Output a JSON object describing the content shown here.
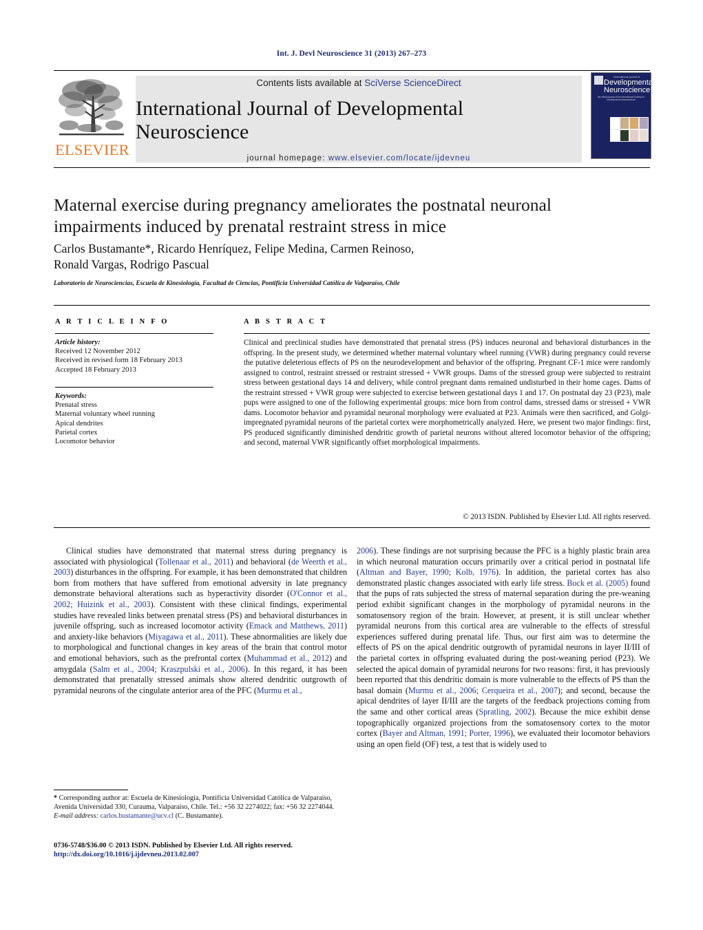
{
  "running_head": "Int. J. Devl Neuroscience 31 (2013) 267–273",
  "masthead": {
    "contents_prefix": "Contents lists available at ",
    "contents_link": "SciVerse ScienceDirect",
    "journal_title": "International Journal of Developmental Neuroscience",
    "homepage_label": "journal homepage:",
    "homepage_url": "www.elsevier.com/locate/ijdevneu",
    "publisher_wordmark": "ELSEVIER",
    "publisher_logo_icon": "elsevier-tree-icon",
    "accent_orange": "#e87722",
    "link_blue": "#2b3a8f"
  },
  "cover": {
    "kicker": "international journal of",
    "title_line1": "Developmental",
    "title_line2": "Neuroscience",
    "subtitle": "the official journal of the International Society for Developmental Neuroscience",
    "background": "#1a2260",
    "panel_colors": [
      "#c9b08a",
      "#d8a96b",
      "#b9a6c4",
      "#8d9cc0",
      "#2a3a2a",
      "#e3cfc7",
      "#ddd0c4",
      "#efe7e0"
    ]
  },
  "article": {
    "title": "Maternal exercise during pregnancy ameliorates the postnatal neuronal impairments induced by prenatal restraint stress in mice",
    "authors_line1": "Carlos Bustamante*, Ricardo Henríquez, Felipe Medina, Carmen Reinoso,",
    "authors_line2": "Ronald Vargas, Rodrigo Pascual",
    "affiliation": "Laboratorio de Neurociencias, Escuela de Kinesiología, Facultad de Ciencias, Pontificia Universidad Católica de Valparaíso, Chile"
  },
  "article_info": {
    "heading": "A R T I C L E   I N F O",
    "history_label": "Article history:",
    "history": [
      "Received 12 November 2012",
      "Received in revised form 18 February 2013",
      "Accepted 18 February 2013"
    ],
    "keywords_label": "Keywords:",
    "keywords": [
      "Prenatal stress",
      "Maternal voluntary wheel running",
      "Apical dendrites",
      "Parietal cortex",
      "Locomotor behavior"
    ]
  },
  "abstract": {
    "heading": "A B S T R A C T",
    "text": "Clinical and preclinical studies have demonstrated that prenatal stress (PS) induces neuronal and behavioral disturbances in the offspring. In the present study, we determined whether maternal voluntary wheel running (VWR) during pregnancy could reverse the putative deleterious effects of PS on the neurodevelopment and behavior of the offspring. Pregnant CF-1 mice were randomly assigned to control, restraint stressed or restraint stressed + VWR groups. Dams of the stressed group were subjected to restraint stress between gestational days 14 and delivery, while control pregnant dams remained undisturbed in their home cages. Dams of the restraint stressed + VWR group were subjected to exercise between gestational days 1 and 17. On postnatal day 23 (P23), male pups were assigned to one of the following experimental groups: mice born from control dams, stressed dams or stressed + VWR dams. Locomotor behavior and pyramidal neuronal morphology were evaluated at P23. Animals were then sacrificed, and Golgi-impregnated pyramidal neurons of the parietal cortex were morphometrically analyzed. Here, we present two major findings: first, PS produced significantly diminished dendritic growth of parietal neurons without altered locomotor behavior of the offspring; and second, maternal VWR significantly offset morphological impairments.",
    "copyright": "© 2013 ISDN. Published by Elsevier Ltd. All rights reserved."
  },
  "body": {
    "left_column_html": "Clinical studies have demonstrated that maternal stress during pregnancy is associated with physiological (<span class=\"ref\">Tollenaar et al., 2011</span>) and behavioral (<span class=\"ref\">de Weerth et al., 2003</span>) disturbances in the offspring. For example, it has been demonstrated that children born from mothers that have suffered from emotional adversity in late pregnancy demonstrate behavioral alterations such as hyperactivity disorder (<span class=\"ref\">O'Connor et al., 2002; Huizink et al., 2003</span>). Consistent with these clinical findings, experimental studies have revealed links between prenatal stress (PS) and behavioral disturbances in juvenile offspring, such as increased locomotor activity (<span class=\"ref\">Emack and Matthews, 2011</span>) and anxiety-like behaviors (<span class=\"ref\">Miyagawa et al., 2011</span>). These abnormalities are likely due to morphological and functional changes in key areas of the brain that control motor and emotional behaviors, such as the prefrontal cortex (<span class=\"ref\">Muhammad et al., 2012</span>) and amygdala (<span class=\"ref\">Salm et al., 2004; Kraszpulski et al., 2006</span>). In this regard, it has been demonstrated that prenatally stressed animals show altered dendritic outgrowth of pyramidal neurons of the cingulate anterior area of the PFC (<span class=\"ref\">Murmu et al.,</span>",
    "right_column_html": "<span class=\"ref\">2006</span>). These findings are not surprising because the PFC is a highly plastic brain area in which neuronal maturation occurs primarily over a critical period in postnatal life (<span class=\"ref\">Altman and Bayer, 1990; Kolb, 1976</span>). In addition, the parietal cortex has also demonstrated plastic changes associated with early life stress. <span class=\"ref\">Bock et al. (2005)</span> found that the pups of rats subjected the stress of maternal separation during the pre-weaning period exhibit significant changes in the morphology of pyramidal neurons in the somatosensory region of the brain. However, at present, it is still unclear whether pyramidal neurons from this cortical area are vulnerable to the effects of stressful experiences suffered during prenatal life. Thus, our first aim was to determine the effects of PS on the apical dendritic outgrowth of pyramidal neurons in layer II/III of the parietal cortex in offspring evaluated during the post-weaning period (P23). We selected the apical domain of pyramidal neurons for two reasons: first, it has previously been reported that this dendritic domain is more vulnerable to the effects of PS than the basal domain (<span class=\"ref\">Murmu et al., 2006; Cerqueira et al., 2007</span>); and second, because the apical dendrites of layer II/III are the targets of the feedback projections coming from the same and other cortical areas (<span class=\"ref\">Spratling, 2002</span>). Because the mice exhibit dense topographically organized projections from the somatosensory cortex to the motor cortex (<span class=\"ref\">Bayer and Altman, 1991; Porter, 1996</span>), we evaluated their locomotor behaviors using an open field (OF) test, a test that is widely used to"
  },
  "footnote": {
    "text_html": "<b>*</b> Corresponding author at: Escuela de Kinesiología, Pontificia Universidad Católica de Valparaíso, Avenida Universidad 330, Curauma, Valparaíso, Chile. Tel.: +56 32 2274022; fax: +56 32 2274044.",
    "email_label": "E-mail address:",
    "email": "carlos.bustamante@ucv.cl",
    "email_owner": "(C. Bustamante)."
  },
  "imprint": {
    "line1": "0736-5748/$36.00 © 2013 ISDN. Published by Elsevier Ltd. All rights reserved.",
    "doi": "http://dx.doi.org/10.1016/j.ijdevneu.2013.02.007"
  }
}
